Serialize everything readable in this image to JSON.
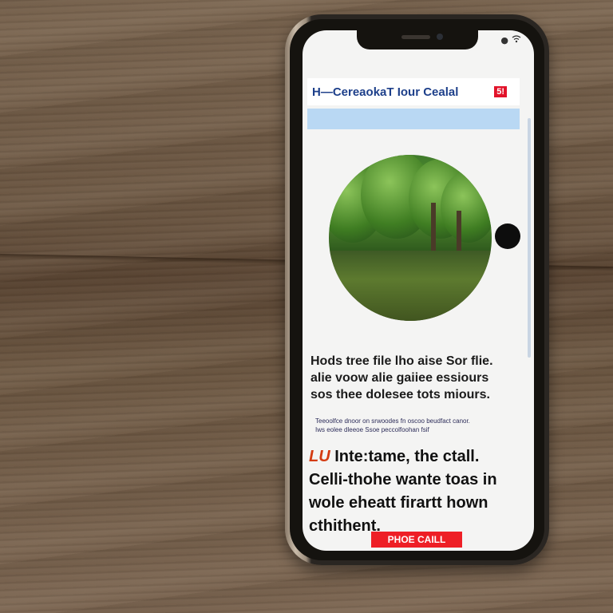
{
  "status_bar": {
    "wifi_icon": "wifi-icon",
    "signal_icon": "signal-icon"
  },
  "header": {
    "title": "H—CereaokaT Iour Cealal",
    "badge": "5!"
  },
  "article": {
    "headline_lines": [
      "Hods tree file lho aise Sor flie.",
      "alie voow alie gaiiee essiours",
      "sos thee dolesee tots miours."
    ],
    "caption_lines": [
      "Teeoolfce dnoor on srwoodes fn oscoo beudfact canor.",
      "Iws eolee dleeoe Ssoe peccolfoohan fsif"
    ],
    "lead_accent": "LU",
    "lead_lines": [
      "Inte:tame, the ctall.",
      "Celli-thohe wante toas in",
      "wole eheatt firartt hown",
      "cthithent."
    ],
    "cta_label": "PHOE CAILL"
  },
  "colors": {
    "title": "#1d3f8a",
    "banner": "#b9d8f3",
    "cta": "#ee1f26",
    "accent": "#d43b12"
  }
}
